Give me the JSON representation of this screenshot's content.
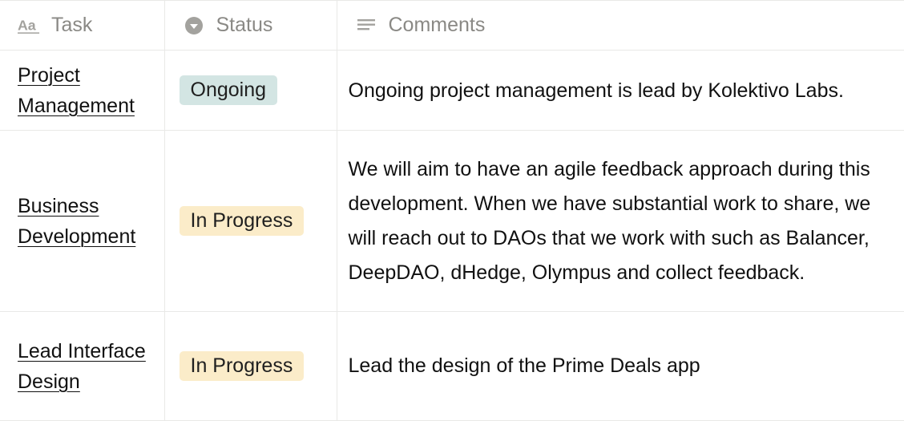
{
  "table": {
    "columns": [
      {
        "label": "Task",
        "icon": "title-aa-icon"
      },
      {
        "label": "Status",
        "icon": "status-select-icon"
      },
      {
        "label": "Comments",
        "icon": "text-lines-icon"
      }
    ],
    "rows": [
      {
        "task": "Project Management",
        "status": "Ongoing",
        "status_color": "#d3e5e3",
        "comments": "Ongoing project management is lead by Kolektivo Labs."
      },
      {
        "task": "Business Development",
        "status": "In Progress",
        "status_color": "#fbecc9",
        "comments": "We will aim to have an agile feedback approach during this development. When we have substantial work to share, we will reach out to DAOs that we work with such as Balancer, DeepDAO, dHedge, Olympus and collect feedback."
      },
      {
        "task": "Lead Interface Design",
        "status": "In Progress",
        "status_color": "#fbecc9",
        "comments": "Lead the design of the Prime Deals app"
      }
    ]
  },
  "colors": {
    "header_text": "#8a8985",
    "border": "#e9e9e7"
  }
}
